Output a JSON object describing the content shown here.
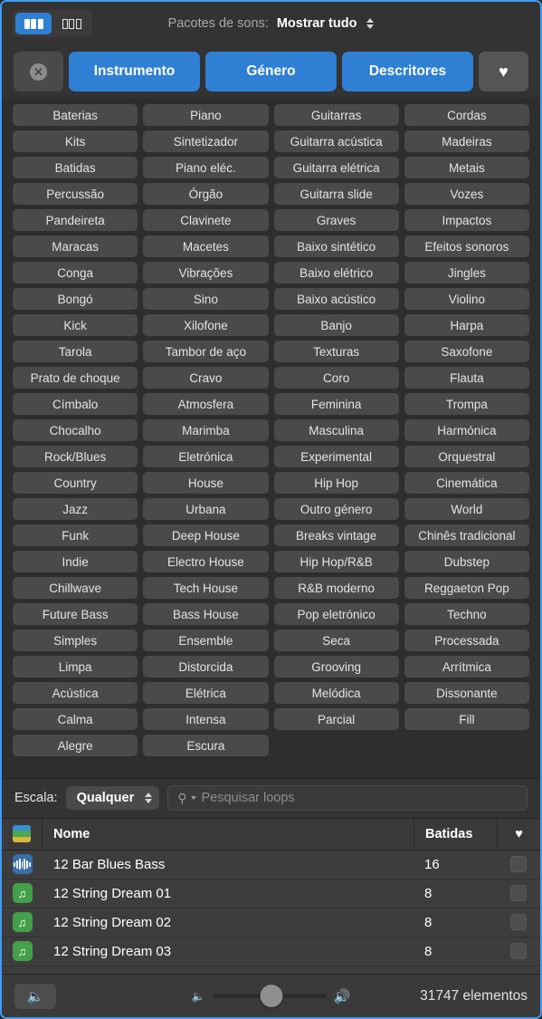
{
  "header": {
    "view_toggle": {
      "grid_rounded_label": "rounded-column-view",
      "grid_square_label": "column-view"
    },
    "packs_label": "Pacotes de sons:",
    "packs_value": "Mostrar tudo"
  },
  "filters": {
    "reset_label": "✕",
    "buttons": [
      "Instrumento",
      "Género",
      "Descritores"
    ],
    "favorite_label": "♥"
  },
  "accent_color": "#2f7fd4",
  "tag_rows": [
    {
      "span": 1,
      "cells": [
        "Baterias",
        "Piano",
        "Guitarras",
        "Cordas"
      ]
    },
    {
      "span": 1,
      "cells": [
        "Kits",
        "Sintetizador",
        "Guitarra acústica",
        "Madeiras"
      ]
    },
    {
      "span": 1,
      "cells": [
        "Batidas",
        "Piano eléc.",
        "Guitarra elétrica",
        "Metais"
      ]
    },
    {
      "span": 1,
      "cells": [
        "Percussão",
        "Órgão",
        "Guitarra slide",
        "Vozes"
      ]
    },
    {
      "span": 1,
      "cells": [
        "Pandeireta",
        "Clavinete",
        "Graves",
        "Impactos"
      ]
    },
    {
      "span": 1,
      "cells": [
        "Maracas",
        "Macetes",
        "Baixo sintético",
        "Efeitos sonoros"
      ]
    },
    {
      "span": 1,
      "cells": [
        "Conga",
        "Vibrações",
        "Baixo elétrico",
        "Jingles"
      ]
    },
    {
      "span": 1,
      "cells": [
        "Bongó",
        "Sino",
        "Baixo acústico",
        "Violino"
      ]
    },
    {
      "span": 1,
      "cells": [
        "Kick",
        "Xilofone",
        "Banjo",
        "Harpa"
      ]
    },
    {
      "span": 1,
      "cells": [
        "Tarola",
        "Tambor de aço",
        "Texturas",
        "Saxofone"
      ]
    },
    {
      "span": 1,
      "cells": [
        "Prato de choque",
        "Cravo",
        "Coro",
        "Flauta"
      ]
    },
    {
      "span": 1,
      "cells": [
        "Címbalo",
        "Atmosfera",
        "Feminina",
        "Trompa"
      ]
    },
    {
      "span": 1,
      "cells": [
        "Chocalho",
        "Marimba",
        "Masculina",
        "Harmónica"
      ]
    },
    {
      "span": 1,
      "cells": [
        "Rock/Blues",
        "Eletrónica",
        "Experimental",
        "Orquestral"
      ]
    },
    {
      "span": 1,
      "cells": [
        "Country",
        "House",
        "Hip Hop",
        "Cinemática"
      ]
    },
    {
      "span": 1,
      "cells": [
        "Jazz",
        "Urbana",
        "Outro género",
        "World"
      ]
    },
    {
      "span": 1,
      "cells": [
        "Funk",
        "Deep House",
        "Breaks vintage",
        "Chinês tradicional"
      ]
    },
    {
      "span": 1,
      "cells": [
        "Indie",
        "Electro House",
        "Hip Hop/R&B",
        "Dubstep"
      ]
    },
    {
      "span": 1,
      "cells": [
        "Chillwave",
        "Tech House",
        "R&B moderno",
        "Reggaeton Pop"
      ]
    },
    {
      "span": 1,
      "cells": [
        "Future Bass",
        "Bass House",
        "Pop eletrónico",
        "Techno"
      ]
    },
    {
      "span": 2,
      "cells": [
        "Simples",
        "Ensemble",
        "Seca",
        "Processada"
      ]
    },
    {
      "span": 2,
      "cells": [
        "Limpa",
        "Distorcida",
        "Grooving",
        "Arrítmica"
      ]
    },
    {
      "span": 2,
      "cells": [
        "Acústica",
        "Elétrica",
        "Melódica",
        "Dissonante"
      ]
    },
    {
      "span": 2,
      "cells": [
        "Calma",
        "Intensa",
        "Parcial",
        "Fill"
      ]
    },
    {
      "span": 2,
      "cells": [
        "Alegre",
        "Escura",
        "",
        ""
      ]
    }
  ],
  "search": {
    "scale_label": "Escala:",
    "scale_value": "Qualquer",
    "placeholder": "Pesquisar loops",
    "value": ""
  },
  "list": {
    "columns": {
      "name": "Nome",
      "beats": "Batidas",
      "favorite": "♥"
    },
    "rows": [
      {
        "icon": "waveform-icon",
        "icon_color": "#3a6ea5",
        "name": "12 Bar Blues Bass",
        "beats": "16"
      },
      {
        "icon": "music-note-icon",
        "icon_color": "#44a04a",
        "name": "12 String Dream 01",
        "beats": "8"
      },
      {
        "icon": "music-note-icon",
        "icon_color": "#44a04a",
        "name": "12 String Dream 02",
        "beats": "8"
      },
      {
        "icon": "music-note-icon",
        "icon_color": "#44a04a",
        "name": "12 String Dream 03",
        "beats": "8"
      }
    ]
  },
  "footer": {
    "speaker_label": "🔈",
    "volume_percent": 52,
    "count_label": "31747 elementos"
  }
}
